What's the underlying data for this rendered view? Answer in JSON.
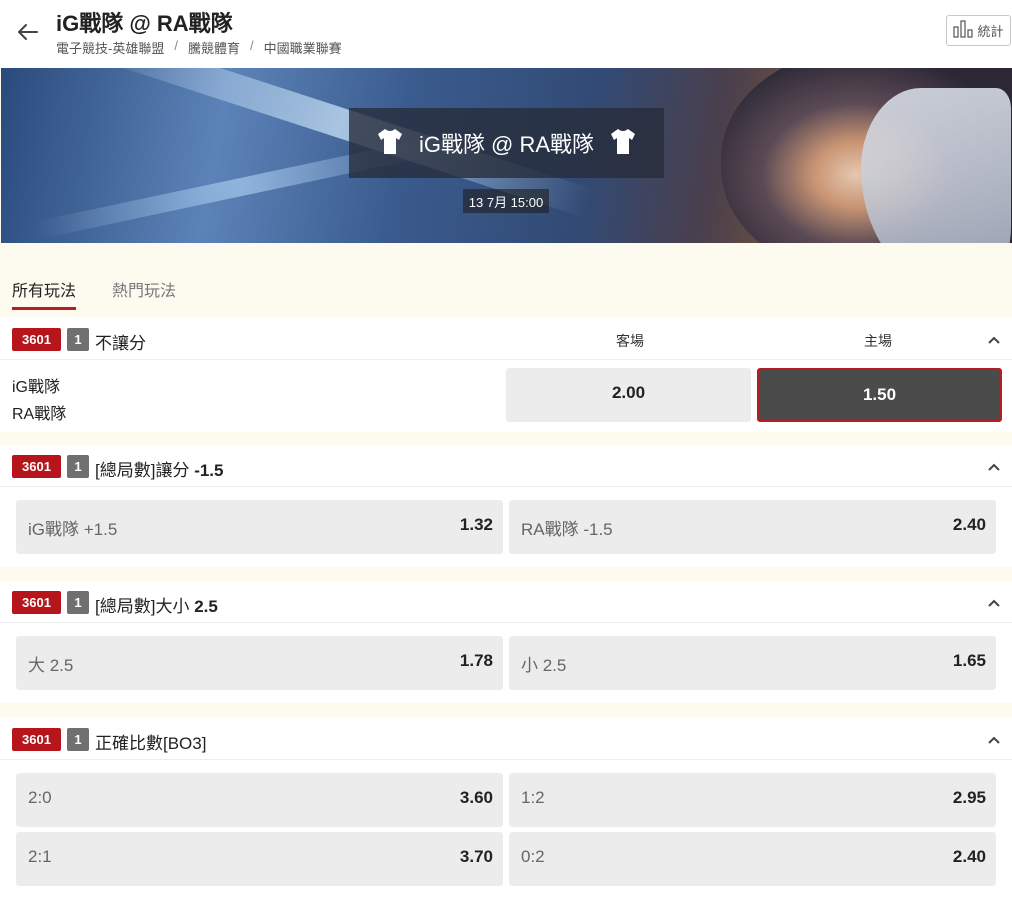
{
  "header": {
    "title": "iG戰隊 @ RA戰隊",
    "breadcrumbs": [
      "電子競技-英雄聯盟",
      "騰競體育",
      "中國職業聯賽"
    ],
    "stats_label": "統計"
  },
  "banner": {
    "match": "iG戰隊 @ RA戰隊",
    "datetime": "13 7月 15:00"
  },
  "tabs": [
    {
      "label": "所有玩法",
      "active": true
    },
    {
      "label": "熱門玩法",
      "active": false
    }
  ],
  "markets": [
    {
      "code": "3601",
      "num": "1",
      "title": "不讓分",
      "col_away": "客場",
      "col_home": "主場",
      "teams": [
        "iG戰隊",
        "RA戰隊"
      ],
      "odds": [
        {
          "label": "",
          "value": "2.00",
          "selected": false
        },
        {
          "label": "",
          "value": "1.50",
          "selected": true
        }
      ]
    },
    {
      "code": "3601",
      "num": "1",
      "title_prefix": "[總局數]讓分",
      "title_value": "-1.5",
      "odds": [
        {
          "label": "iG戰隊 +1.5",
          "value": "1.32"
        },
        {
          "label": "RA戰隊 -1.5",
          "value": "2.40"
        }
      ]
    },
    {
      "code": "3601",
      "num": "1",
      "title_prefix": "[總局數]大小",
      "title_value": "2.5",
      "odds": [
        {
          "label": "大 2.5",
          "value": "1.78"
        },
        {
          "label": "小 2.5",
          "value": "1.65"
        }
      ]
    },
    {
      "code": "3601",
      "num": "1",
      "title": "正確比數[BO3]",
      "odds": [
        {
          "label": "2:0",
          "value": "3.60"
        },
        {
          "label": "1:2",
          "value": "2.95"
        },
        {
          "label": "2:1",
          "value": "3.70"
        },
        {
          "label": "0:2",
          "value": "2.40"
        }
      ]
    }
  ],
  "colors": {
    "accent_red": "#b5151b",
    "badge_grey": "#707070",
    "selected_bg": "#4b4b4b",
    "page_bg": "#fdfaf0"
  },
  "icons": [
    "back-arrow-icon",
    "bar-chart-icon",
    "jersey-icon",
    "chevron-up-icon"
  ]
}
